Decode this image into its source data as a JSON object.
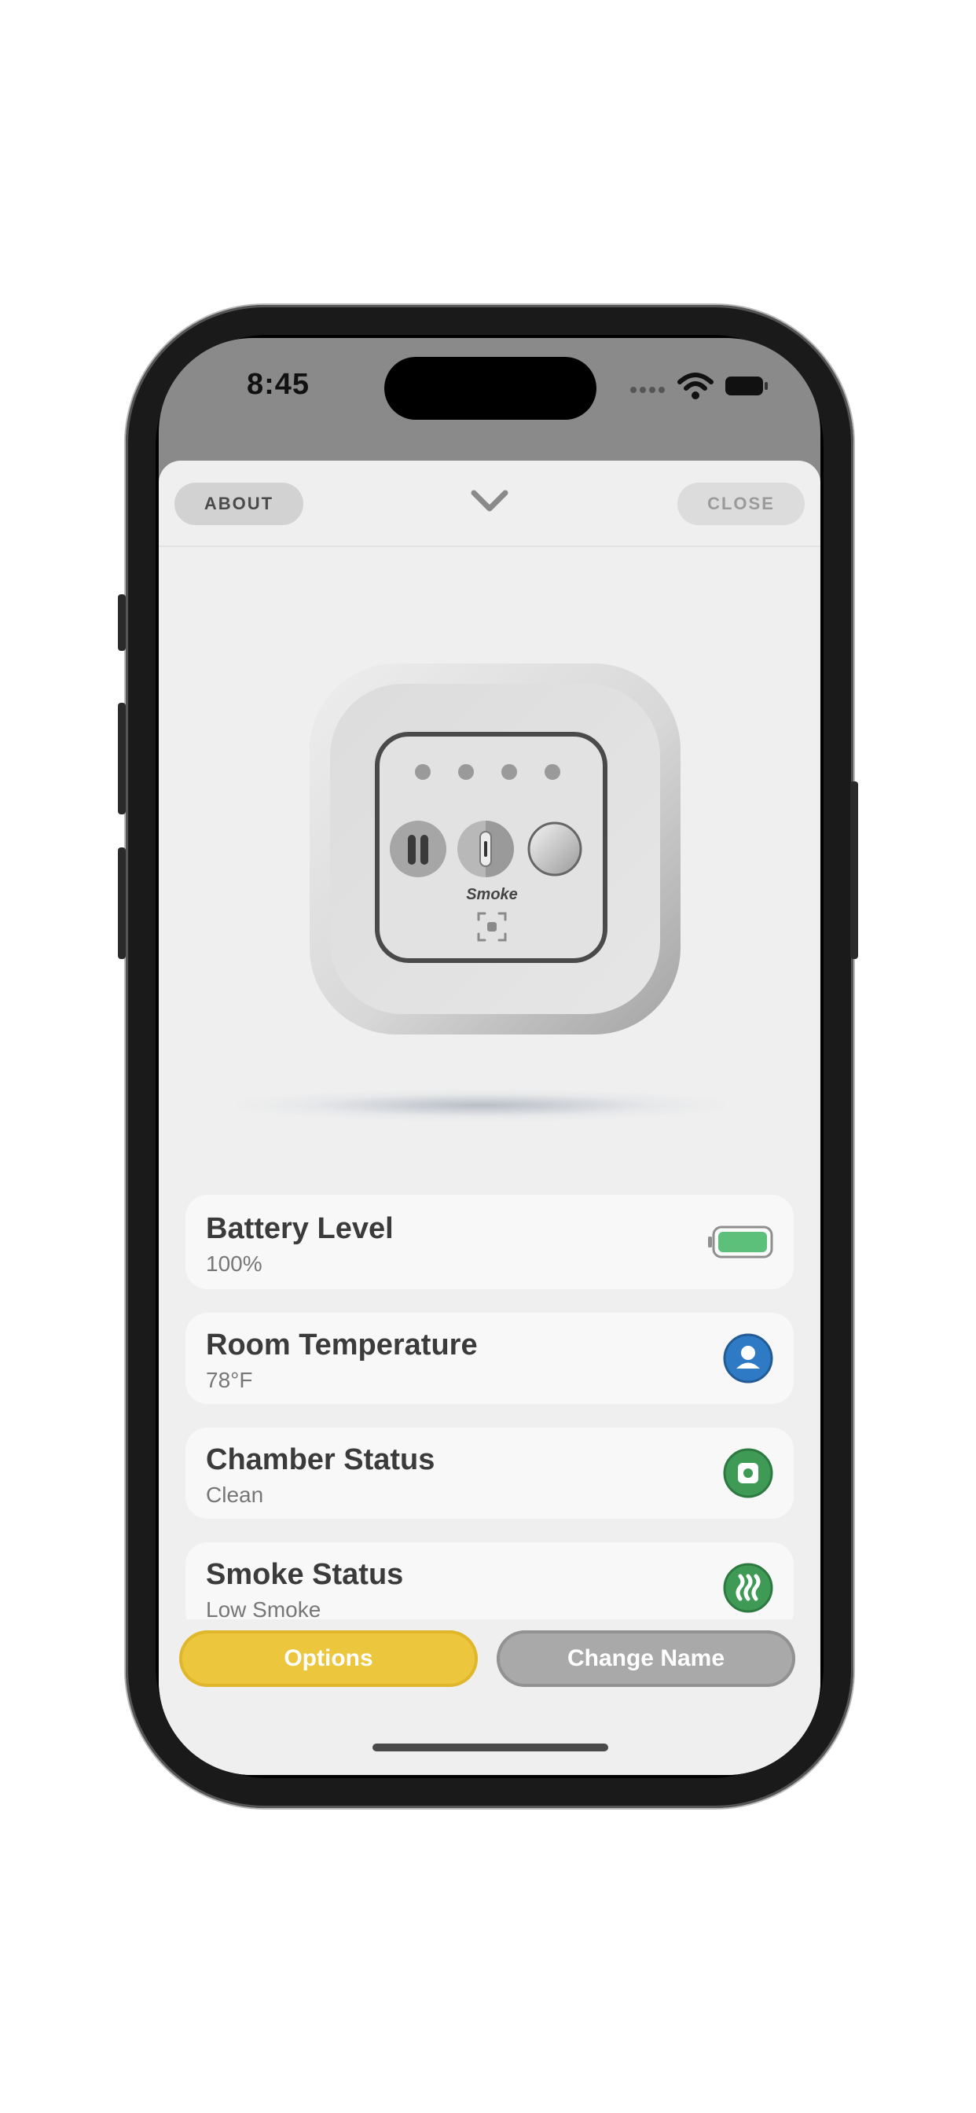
{
  "status_bar": {
    "time": "8:45"
  },
  "header": {
    "about_label": "ABOUT",
    "close_label": "CLOSE"
  },
  "device": {
    "label": "Smoke"
  },
  "cards": [
    {
      "title": "Battery Level",
      "value": "100%",
      "icon": "battery-full-icon",
      "color": "#5cc07a"
    },
    {
      "title": "Room Temperature",
      "value": "78°F",
      "icon": "person-circle-icon",
      "color": "#2f7ac4"
    },
    {
      "title": "Chamber Status",
      "value": "Clean",
      "icon": "chamber-icon",
      "color": "#3f9a55"
    },
    {
      "title": "Smoke Status",
      "value": "Low Smoke",
      "icon": "smoke-icon",
      "color": "#3f9a55"
    }
  ],
  "actions": {
    "options_label": "Options",
    "change_name_label": "Change Name"
  },
  "colors": {
    "accent_yellow": "#ecc63c",
    "secondary_gray": "#a9a9a9",
    "status_green": "#3f9a55",
    "status_blue": "#2f7ac4"
  }
}
